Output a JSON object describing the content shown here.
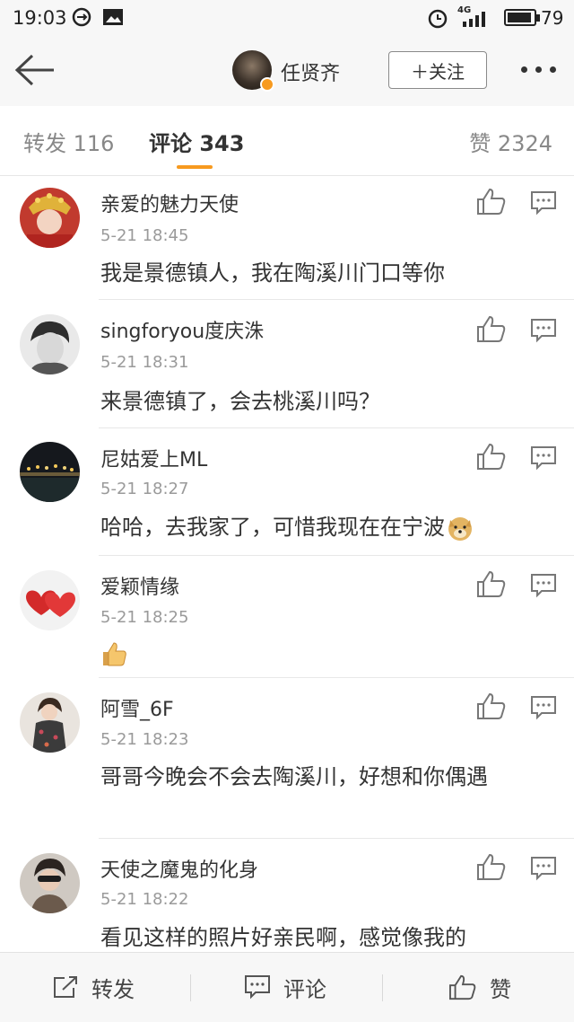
{
  "status_bar": {
    "time": "19:03",
    "network": "4G",
    "battery": "79"
  },
  "header": {
    "title": "任贤齐",
    "follow_label": "＋关注"
  },
  "tabs": [
    {
      "label": "转发 116"
    },
    {
      "label": "评论 343"
    },
    {
      "label": "赞 2324"
    }
  ],
  "comments": [
    {
      "user": "亲爱的魅力天使",
      "time": "5-21 18:45",
      "text": "我是景德镇人，我在陶溪川门口等你"
    },
    {
      "user": "singforyou度庆洙",
      "time": "5-21 18:31",
      "text": "来景德镇了，会去桃溪川吗？"
    },
    {
      "user": "尼姑爱上ML",
      "time": "5-21 18:27",
      "text": "哈哈，去我家了，可惜我现在在宁波"
    },
    {
      "user": "爱颖情缘",
      "time": "5-21 18:25",
      "text": ""
    },
    {
      "user": "阿雪_6F",
      "time": "5-21 18:23",
      "text": "哥哥今晚会不会去陶溪川，好想和你偶遇"
    },
    {
      "user": "天使之魔鬼的化身",
      "time": "5-21 18:22",
      "text": "看见这样的照片好亲民啊，感觉像我的"
    }
  ],
  "bottom_bar": {
    "repost_label": "转发",
    "comment_label": "评论",
    "like_label": "赞"
  },
  "colors": {
    "accent": "#f79a1f",
    "text": "#333333",
    "muted": "#9a9a9a",
    "bar_bg": "#f7f7f7"
  }
}
